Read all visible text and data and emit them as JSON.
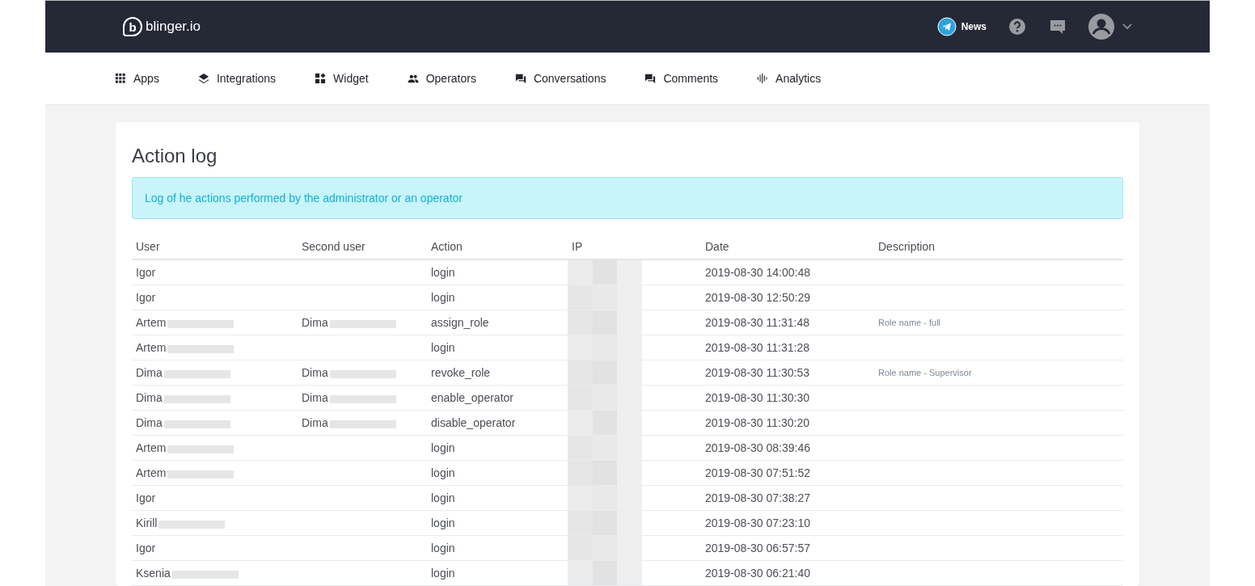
{
  "header": {
    "logo_letter": "b",
    "logo_text": "blinger.io",
    "news": "News"
  },
  "nav": [
    {
      "label": "Apps",
      "kind": "apps"
    },
    {
      "label": "Integrations",
      "kind": "layers"
    },
    {
      "label": "Widget",
      "kind": "widget"
    },
    {
      "label": "Operators",
      "kind": "people"
    },
    {
      "label": "Conversations",
      "kind": "chat"
    },
    {
      "label": "Comments",
      "kind": "chat"
    },
    {
      "label": "Analytics",
      "kind": "wave"
    }
  ],
  "page": {
    "title": "Action log",
    "notice": "Log of he actions performed by the administrator or an operator"
  },
  "table": {
    "columns": [
      "User",
      "Second user",
      "Action",
      "IP",
      "Date",
      "Description"
    ],
    "rows": [
      {
        "user": "Igor",
        "action": "login",
        "ip_redacted": true,
        "date": "2019-08-30 14:00:48"
      },
      {
        "user": "Igor",
        "action": "login",
        "ip_redacted": true,
        "date": "2019-08-30 12:50:29"
      },
      {
        "user": "Artem",
        "user_redacted": true,
        "second_user": "Dima",
        "second_redacted": true,
        "action": "assign_role",
        "ip_redacted": true,
        "date": "2019-08-30 11:31:48",
        "description": "Role name - full"
      },
      {
        "user": "Artem",
        "user_redacted": true,
        "action": "login",
        "ip_redacted": true,
        "date": "2019-08-30 11:31:28"
      },
      {
        "user": "Dima",
        "user_redacted": true,
        "second_user": "Dima",
        "second_redacted": true,
        "action": "revoke_role",
        "ip_redacted": true,
        "date": "2019-08-30 11:30:53",
        "description": "Role name - Supervisor"
      },
      {
        "user": "Dima",
        "user_redacted": true,
        "second_user": "Dima",
        "second_redacted": true,
        "action": "enable_operator",
        "ip_redacted": true,
        "date": "2019-08-30 11:30:30"
      },
      {
        "user": "Dima",
        "user_redacted": true,
        "second_user": "Dima",
        "second_redacted": true,
        "action": "disable_operator",
        "ip_redacted": true,
        "date": "2019-08-30 11:30:20"
      },
      {
        "user": "Artem",
        "user_redacted": true,
        "action": "login",
        "ip_redacted": true,
        "date": "2019-08-30 08:39:46"
      },
      {
        "user": "Artem",
        "user_redacted": true,
        "action": "login",
        "ip_redacted": true,
        "date": "2019-08-30 07:51:52"
      },
      {
        "user": "Igor",
        "action": "login",
        "ip_redacted": true,
        "date": "2019-08-30 07:38:27"
      },
      {
        "user": "Kirill",
        "user_redacted": true,
        "action": "login",
        "ip_redacted": true,
        "date": "2019-08-30 07:23:10"
      },
      {
        "user": "Igor",
        "action": "login",
        "ip_redacted": true,
        "date": "2019-08-30 06:57:57"
      },
      {
        "user": "Ksenia",
        "user_redacted": true,
        "action": "login",
        "ip_redacted": true,
        "date": "2019-08-30 06:21:40"
      }
    ]
  }
}
